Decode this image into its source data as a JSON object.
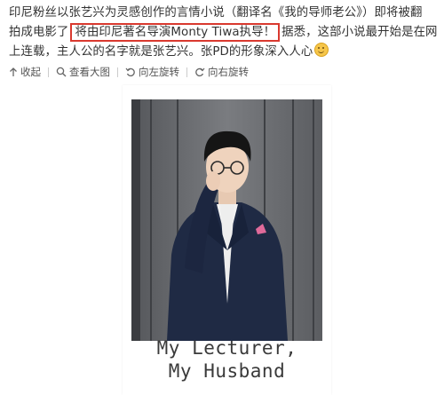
{
  "post": {
    "line1": "印尼粉丝以张艺兴为灵感创作的言情小说（翻译名《我的导师老公》）即将被翻",
    "line2_before": "拍成电影了",
    "line2_highlight": "将由印尼著名导演Monty Tiwa执导！",
    "line2_after": "据悉，这部小说最开始是在网",
    "line3": "上连载，主人公的名字就是张艺兴。张PD的形象深入人心",
    "emoji_icon": "grin-sweat-emoji-icon"
  },
  "toolbar": {
    "collapse_label": "收起",
    "view_large_label": "查看大图",
    "rotate_left_label": "向左旋转",
    "rotate_right_label": "向右旋转"
  },
  "image": {
    "caption_line1": "My Lecturer,",
    "caption_line2": "My Husband"
  },
  "colors": {
    "highlight_border": "#d9392f",
    "text": "#333333"
  }
}
